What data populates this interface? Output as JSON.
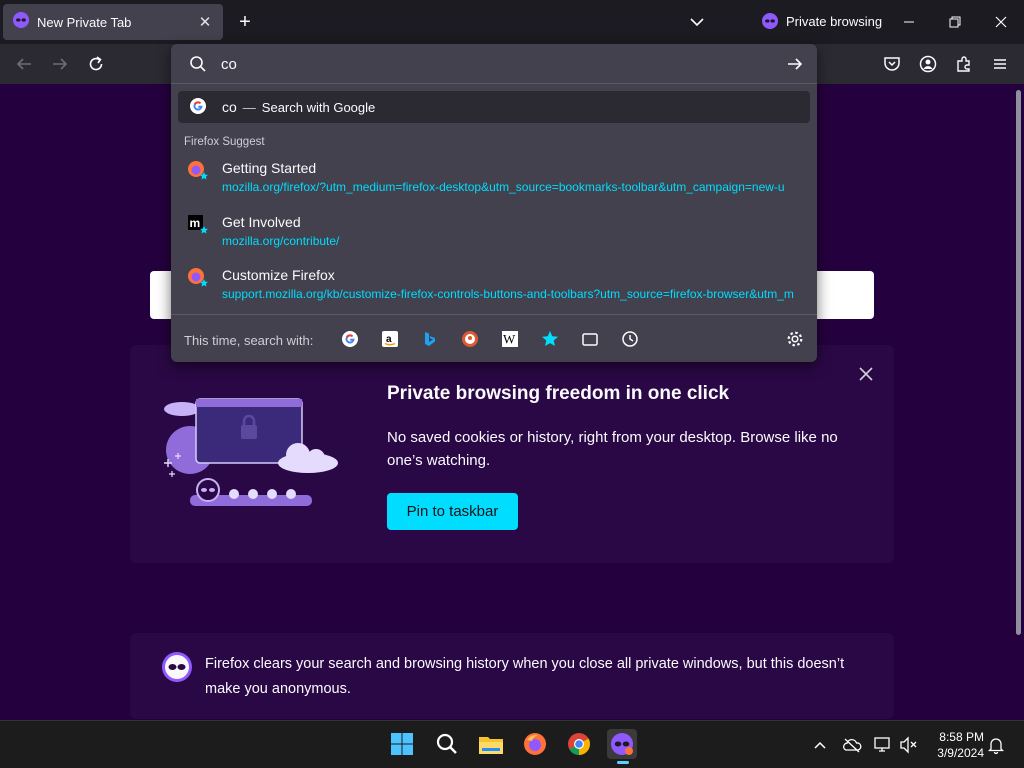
{
  "tab": {
    "title": "New Private Tab"
  },
  "private_indicator": {
    "label": "Private browsing"
  },
  "urlbar": {
    "value": "co",
    "search_row": {
      "query": "co",
      "separator": "—",
      "action": "Search with Google"
    },
    "section_label": "Firefox Suggest",
    "suggestions": [
      {
        "title": "Getting Started",
        "url": "mozilla.org/firefox/?utm_medium=firefox-desktop&utm_source=bookmarks-toolbar&utm_campaign=new-u",
        "icon": "firefox-icon"
      },
      {
        "title": "Get Involved",
        "url": "mozilla.org/contribute/",
        "icon": "mozilla-icon"
      },
      {
        "title": "Customize Firefox",
        "url": "support.mozilla.org/kb/customize-firefox-controls-buttons-and-toolbars?utm_source=firefox-browser&utm_m",
        "icon": "firefox-icon"
      }
    ],
    "one_off_label": "This time, search with:",
    "engines": [
      "google-icon",
      "amazon-icon",
      "bing-icon",
      "duckduckgo-icon",
      "wikipedia-icon",
      "bookmarks-icon",
      "tabs-icon",
      "history-icon"
    ]
  },
  "promo": {
    "title": "Private browsing freedom in one click",
    "text": "No saved cookies or history, right from your desktop. Browse like no one’s watching.",
    "button": "Pin to taskbar"
  },
  "footer": {
    "text": "Firefox clears your search and browsing history when you close all private windows, but this doesn’t make you anonymous."
  },
  "taskbar": {
    "apps": [
      "windows-start-icon",
      "search-icon",
      "file-explorer-icon",
      "firefox-icon",
      "chrome-icon",
      "firefox-private-icon"
    ]
  },
  "clock": {
    "time": "8:58 PM",
    "date": "3/9/2024"
  },
  "colors": {
    "accent": "#00ddff",
    "page_bg": "#25003e",
    "panel_bg": "#42414d"
  }
}
